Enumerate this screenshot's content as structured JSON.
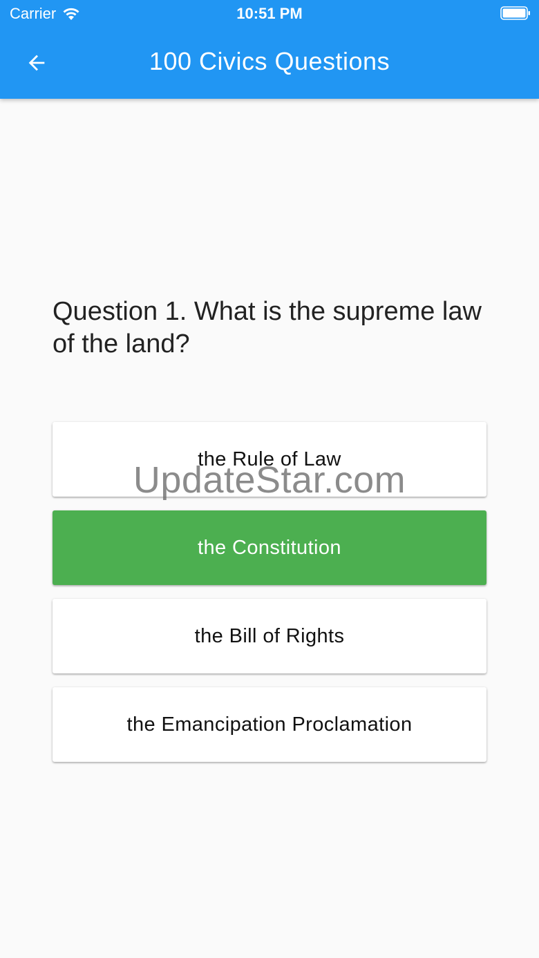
{
  "status_bar": {
    "carrier": "Carrier",
    "time": "10:51 PM"
  },
  "app_bar": {
    "title": "100 Civics Questions",
    "color": "#2196f3"
  },
  "question": {
    "text": "Question 1. What is the supreme law of the land?"
  },
  "answers": [
    {
      "label": "the Rule of Law",
      "state": "default"
    },
    {
      "label": "the Constitution",
      "state": "correct",
      "color": "#4caf50"
    },
    {
      "label": "the Bill of Rights",
      "state": "default"
    },
    {
      "label": "the Emancipation Proclamation",
      "state": "default"
    }
  ],
  "watermark": "UpdateStar.com",
  "icons": {
    "back": "arrow-left-icon",
    "wifi": "wifi-icon",
    "battery": "battery-icon"
  }
}
